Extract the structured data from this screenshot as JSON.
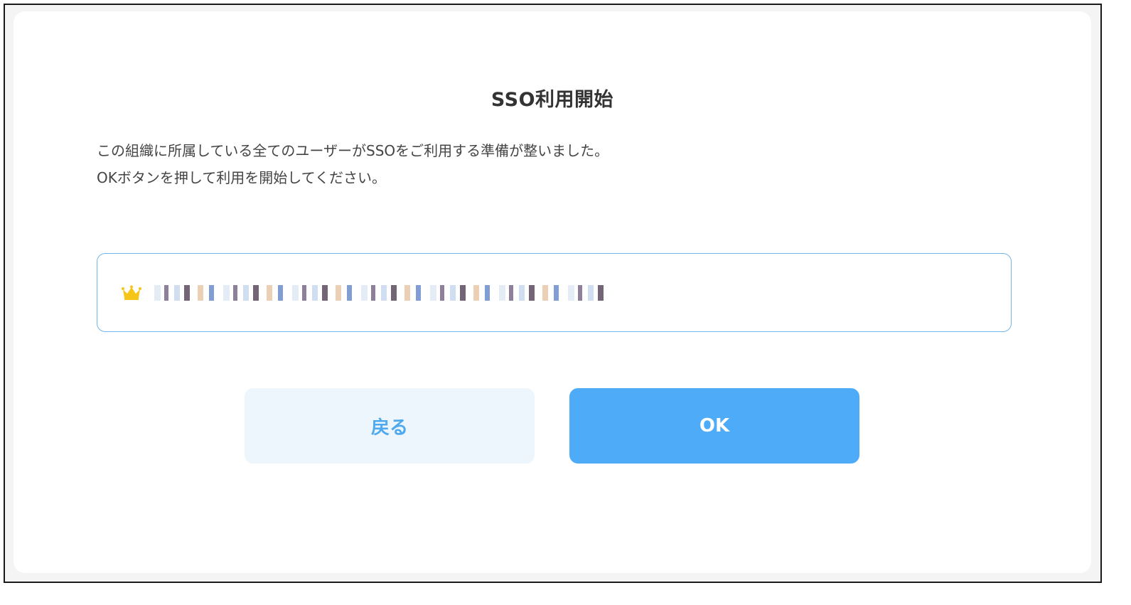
{
  "dialog": {
    "title": "SSO利用開始",
    "description_lines": [
      "この組織に所属している全てのユーザーがSSOをご利用する準備が整いました。",
      "OKボタンを押して利用を開始してください。"
    ]
  },
  "organization_field": {
    "icon": "crown-icon",
    "icon_color": "#f5c518",
    "value": "",
    "border_color": "#6fb5ee"
  },
  "buttons": {
    "back_label": "戻る",
    "ok_label": "OK"
  },
  "colors": {
    "primary": "#4dabf7",
    "primary_light": "#eef6fd",
    "text": "#333333"
  }
}
